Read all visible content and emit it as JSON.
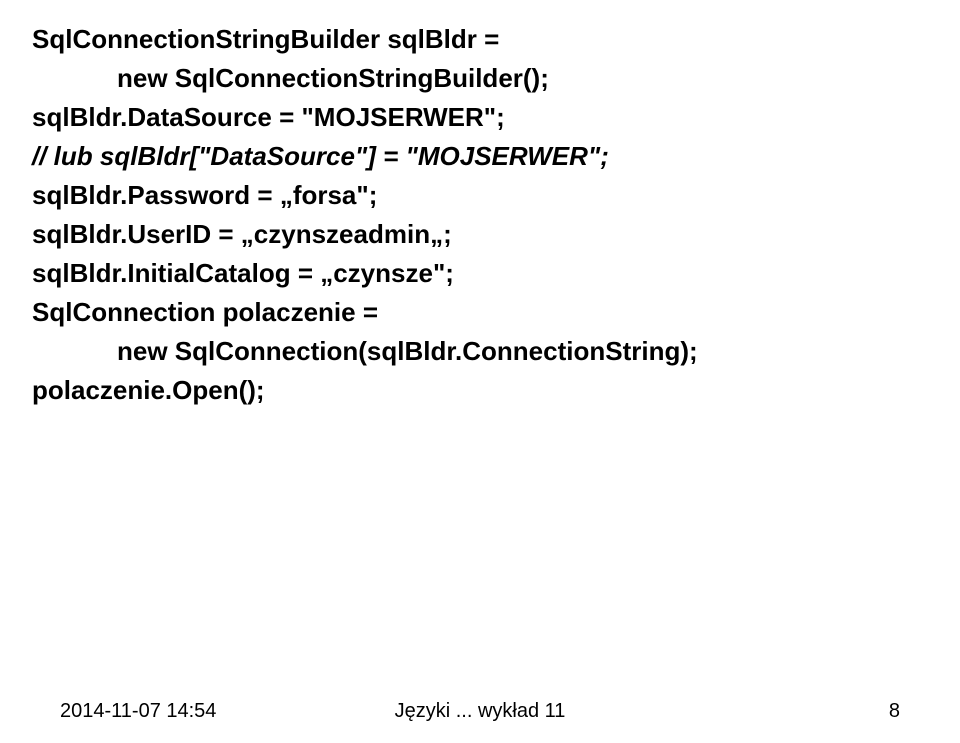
{
  "code": {
    "line1": "SqlConnectionStringBuilder sqlBldr =",
    "line2": "new SqlConnectionStringBuilder();",
    "line3": "sqlBldr.DataSource = \"MOJSERWER\";",
    "line4": "// lub sqlBldr[\"DataSource\"] = \"MOJSERWER\";",
    "line5": "sqlBldr.Password = „forsa\";",
    "line6": "sqlBldr.UserID = „czynszeadmin„;",
    "line7": "sqlBldr.InitialCatalog = „czynsze\";",
    "line8": "SqlConnection polaczenie =",
    "line9": "new SqlConnection(sqlBldr.ConnectionString);",
    "line10": "polaczenie.Open();"
  },
  "footer": {
    "date": "2014-11-07 14:54",
    "title": "Języki ... wykład 11",
    "page": "8"
  }
}
